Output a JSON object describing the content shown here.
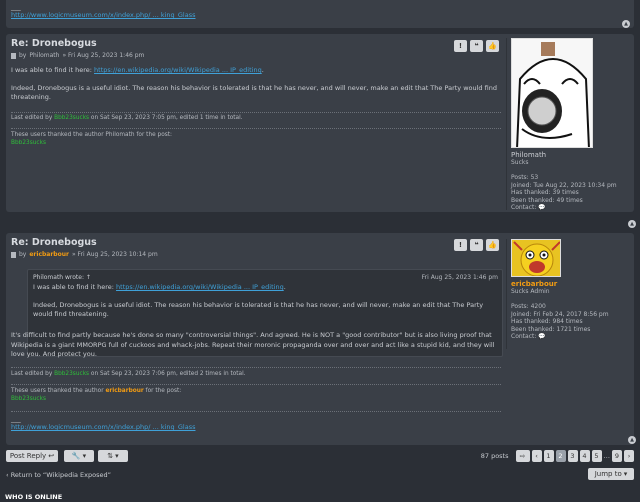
{
  "stub": {
    "sig_dash": "___",
    "sig_link": "http://www.logicmuseum.com/x/index.php/ ... king_Glass"
  },
  "post1": {
    "title": "Re: Dronebogus",
    "by": "by",
    "author": "Philomath",
    "date": "» Fri Aug 25, 2023 1:46 pm",
    "line1_pre": "I was able to find it here: ",
    "line1_link": "https://en.wikipedia.org/wiki/Wikipedia ... IP_editing",
    "line1_post": ".",
    "para2": "Indeed, Dronebogus is a useful idiot. The reason his behavior is tolerated is that he has never, and will never, make an edit that The Party would find threatening.",
    "edited_pre": "Last edited by ",
    "edited_user": "Bbb23sucks",
    "edited_post": " on Sat Sep 23, 2023 7:05 pm, edited 1 time in total.",
    "thanks_line": "These users thanked the author Philomath for the post:",
    "thanks_user": "Bbb23sucks",
    "profile": {
      "name": "Philomath",
      "rank": "Sucks",
      "posts": "Posts: 53",
      "joined": "Joined: Tue Aug 22, 2023 10:34 pm",
      "has_thanked": "Has thanked: 39 times",
      "been_thanked": "Been thanked: 49 times",
      "contact": "Contact:"
    }
  },
  "post2": {
    "title": "Re: Dronebogus",
    "by": "by",
    "author": "ericbarbour",
    "date": "» Fri Aug 25, 2023 10:14 pm",
    "quote_author": "Philomath wrote: ↑",
    "quote_date": "Fri Aug 25, 2023 1:46 pm",
    "quote_line1_pre": "I was able to find it here: ",
    "quote_line1_link": "https://en.wikipedia.org/wiki/Wikipedia ... IP_editing",
    "quote_line1_post": ".",
    "quote_para2": "Indeed, Dronebogus is a useful idiot. The reason his behavior is tolerated is that he has never, and will never, make an edit that The Party would find threatening.",
    "body": "It's difficult to find partly because he's done so many \"controversial things\". And agreed. He is NOT a \"good contributor\" but is also living proof that Wikipedia is a giant MMORPG full of cuckoos and whack-jobs. Repeat their moronic propaganda over and over and act like a stupid kid, and they will love you. And protect you.",
    "edited_pre": "Last edited by ",
    "edited_user": "Bbb23sucks",
    "edited_post": " on Sat Sep 23, 2023 7:06 pm, edited 2 times in total.",
    "thanks_pre": "These users thanked the author ",
    "thanks_author": "ericbarbour",
    "thanks_post": " for the post:",
    "thanks_user": "Bbb23sucks",
    "sig_dash": "___",
    "sig_link": "http://www.logicmuseum.com/x/index.php/ ... king_Glass",
    "profile": {
      "name": "ericbarbour",
      "rank": "Sucks Admin",
      "posts": "Posts: 4200",
      "joined": "Joined: Fri Feb 24, 2017 8:56 pm",
      "has_thanked": "Has thanked: 984 times",
      "been_thanked": "Been thanked: 1721 times",
      "contact": "Contact:"
    }
  },
  "toolbar": {
    "post_reply": "Post Reply",
    "post_count": "87 posts",
    "pages": [
      "1",
      "2",
      "3",
      "4",
      "5",
      "…",
      "9"
    ],
    "current_page": "2"
  },
  "footer": {
    "return_link": "Return to “Wikipedia Exposed”",
    "jump_to": "Jump to",
    "who_online": "WHO IS ONLINE"
  },
  "icons": [
    "warn-icon",
    "quote-icon",
    "thumbs-up-icon",
    "wrench-icon",
    "sort-icon",
    "reply-arrow-icon",
    "chevron-left-icon",
    "chevron-right-icon",
    "contact-icon",
    "top-arrow-icon"
  ]
}
